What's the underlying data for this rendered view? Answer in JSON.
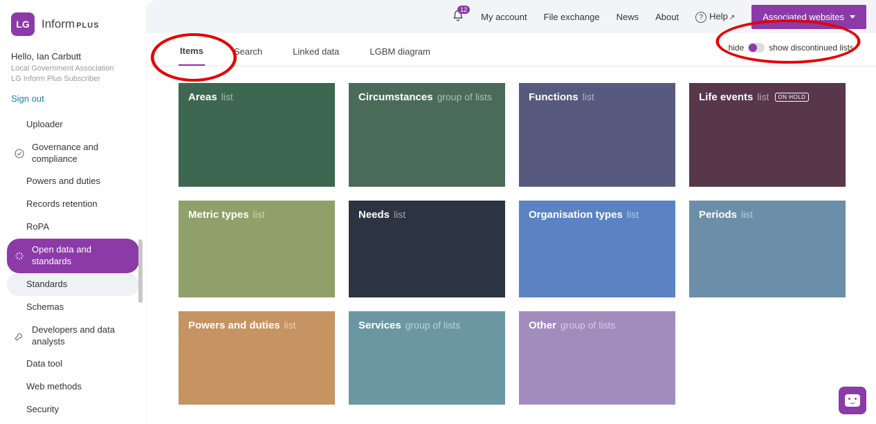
{
  "brand": {
    "badge": "LG",
    "name": "Inform",
    "suffix": "PLUS"
  },
  "user": {
    "hello": "Hello, Ian Carbutt",
    "org": "Local Government Association",
    "role": "LG Inform Plus Subscriber",
    "signout": "Sign out"
  },
  "sidebar": {
    "items": [
      {
        "label": "Uploader",
        "top": false,
        "icon": ""
      },
      {
        "label": "Governance and compliance",
        "top": true,
        "icon": "check"
      },
      {
        "label": "Powers and duties",
        "top": false,
        "icon": ""
      },
      {
        "label": "Records retention",
        "top": false,
        "icon": ""
      },
      {
        "label": "RoPA",
        "top": false,
        "icon": ""
      },
      {
        "label": "Open data and standards",
        "top": true,
        "icon": "spark",
        "active": true
      },
      {
        "label": "Standards",
        "top": false,
        "icon": "",
        "subactive": true
      },
      {
        "label": "Schemas",
        "top": false,
        "icon": ""
      },
      {
        "label": "Developers and data analysts",
        "top": true,
        "icon": "wrench"
      },
      {
        "label": "Data tool",
        "top": false,
        "icon": ""
      },
      {
        "label": "Web methods",
        "top": false,
        "icon": ""
      },
      {
        "label": "Security",
        "top": false,
        "icon": ""
      }
    ]
  },
  "topbar": {
    "notif_count": "12",
    "links": [
      "My account",
      "File exchange",
      "News",
      "About"
    ],
    "help": "Help",
    "assoc": "Associated websites"
  },
  "tabs": [
    "Items",
    "Search",
    "Linked data",
    "LGBM diagram"
  ],
  "active_tab": 0,
  "toggle": {
    "left": "hide",
    "right": "show discontinued lists"
  },
  "cards": [
    {
      "title": "Areas",
      "sub": "list",
      "cls": "c-areas"
    },
    {
      "title": "Circumstances",
      "sub": "group of lists",
      "cls": "c-circ"
    },
    {
      "title": "Functions",
      "sub": "list",
      "cls": "c-func"
    },
    {
      "title": "Life events",
      "sub": "list",
      "cls": "c-life",
      "badge": "ON HOLD"
    },
    {
      "title": "Metric types",
      "sub": "list",
      "cls": "c-metric"
    },
    {
      "title": "Needs",
      "sub": "list",
      "cls": "c-needs"
    },
    {
      "title": "Organisation types",
      "sub": "list",
      "cls": "c-orgtype"
    },
    {
      "title": "Periods",
      "sub": "list",
      "cls": "c-periods"
    },
    {
      "title": "Powers and duties",
      "sub": "list",
      "cls": "c-pow",
      "cut": true
    },
    {
      "title": "Services",
      "sub": "group of lists",
      "cls": "c-serv",
      "cut": true
    },
    {
      "title": "Other",
      "sub": "group of lists",
      "cls": "c-other",
      "cut": true
    }
  ]
}
